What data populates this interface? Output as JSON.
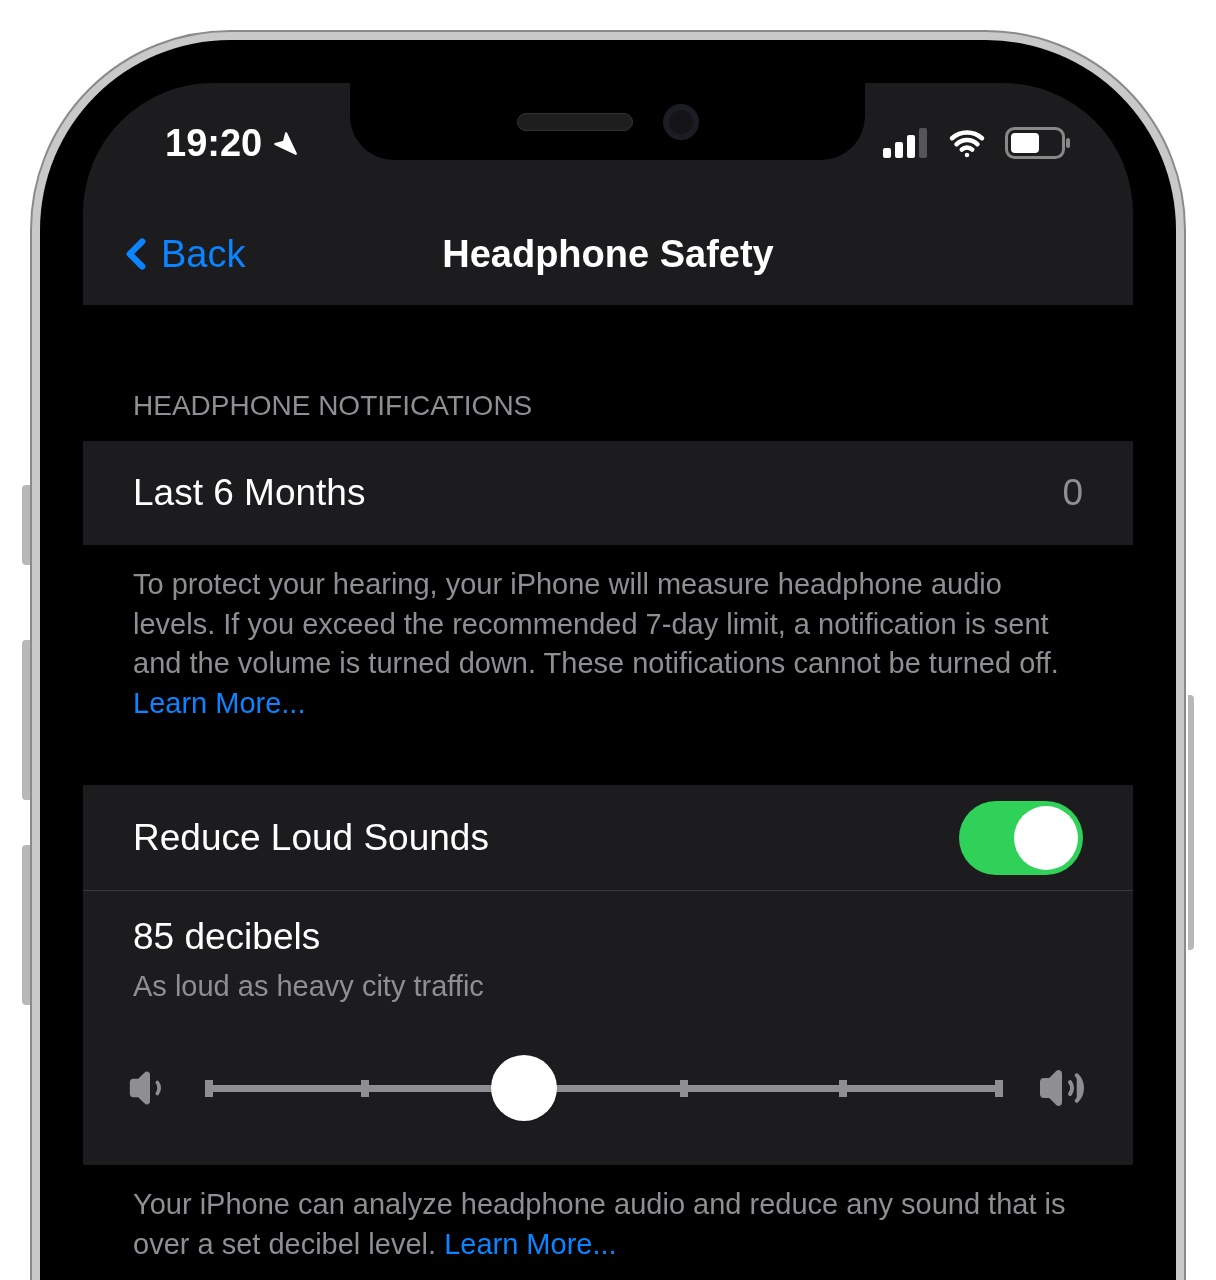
{
  "status_bar": {
    "time": "19:20"
  },
  "nav": {
    "back": "Back",
    "title": "Headphone Safety"
  },
  "notifications": {
    "header": "HEADPHONE NOTIFICATIONS",
    "row": {
      "label": "Last 6 Months",
      "value": "0"
    },
    "footer": "To protect your hearing, your iPhone will measure headphone audio levels. If you exceed the recommended 7-day limit, a notification is sent and the volume is turned down. These notifications cannot be turned off.",
    "footer_link": "Learn More..."
  },
  "reduce": {
    "label": "Reduce Loud Sounds",
    "on": true,
    "decibels": "85 decibels",
    "description": "As loud as heavy city traffic",
    "slider": {
      "level": 0.4
    },
    "footer": "Your iPhone can analyze headphone audio and reduce any sound that is over a set decibel level.",
    "footer_link": "Learn More..."
  }
}
